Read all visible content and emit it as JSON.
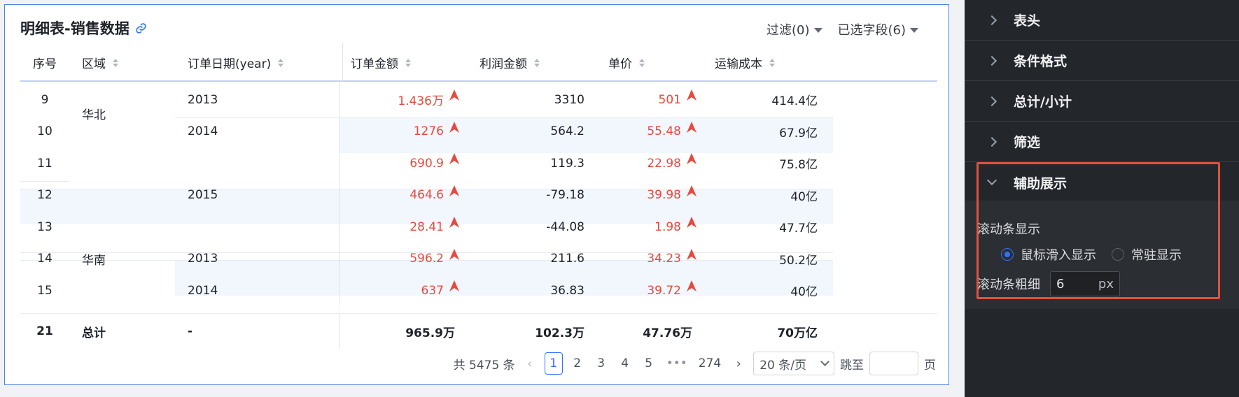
{
  "card": {
    "title": "明细表-销售数据",
    "filter_label": "过滤(0)",
    "fields_label": "已选字段(6)"
  },
  "table": {
    "columns": [
      "序号",
      "区域",
      "订单日期(year)",
      "订单金额",
      "利润金额",
      "单价",
      "运输成本"
    ],
    "rows": [
      {
        "idx": "9",
        "region": "华北",
        "year": "2013",
        "amount": "1.436万",
        "profit": "3310",
        "price": "501",
        "cost": "414.4亿"
      },
      {
        "idx": "10",
        "region": "",
        "year": "2014",
        "amount": "1276",
        "profit": "564.2",
        "price": "55.48",
        "cost": "67.9亿"
      },
      {
        "idx": "11",
        "region": "",
        "year": "",
        "amount": "690.9",
        "profit": "119.3",
        "price": "22.98",
        "cost": "75.8亿"
      },
      {
        "idx": "12",
        "region": "",
        "year": "2015",
        "amount": "464.6",
        "profit": "-79.18",
        "price": "39.98",
        "cost": "40亿"
      },
      {
        "idx": "13",
        "region": "",
        "year": "",
        "amount": "28.41",
        "profit": "-44.08",
        "price": "1.98",
        "cost": "47.7亿"
      },
      {
        "idx": "14",
        "region": "华南",
        "year": "2013",
        "amount": "596.2",
        "profit": "211.6",
        "price": "34.23",
        "cost": "50.2亿"
      },
      {
        "idx": "15",
        "region": "",
        "year": "2014",
        "amount": "637",
        "profit": "36.83",
        "price": "39.72",
        "cost": "40亿"
      }
    ],
    "total": {
      "idx": "21",
      "region": "总计",
      "year": "-",
      "amount": "965.9万",
      "profit": "102.3万",
      "price": "47.76万",
      "cost": "70万亿"
    },
    "accent_color": "#e8483e"
  },
  "pager": {
    "total_text": "共 5475 条",
    "pages": [
      "1",
      "2",
      "3",
      "4",
      "5"
    ],
    "ellipsis": "•••",
    "last_page": "274",
    "page_size": "20 条/页",
    "jump_label": "跳至",
    "page_unit": "页"
  },
  "panel": {
    "sections": [
      "表头",
      "条件格式",
      "总计/小计",
      "筛选",
      "辅助展示"
    ],
    "scroll_title": "滚动条显示",
    "radio_options": [
      "鼠标滑入显示",
      "常驻显示"
    ],
    "thickness_label": "滚动条粗细",
    "thickness_value": "6",
    "thickness_unit": "px"
  }
}
